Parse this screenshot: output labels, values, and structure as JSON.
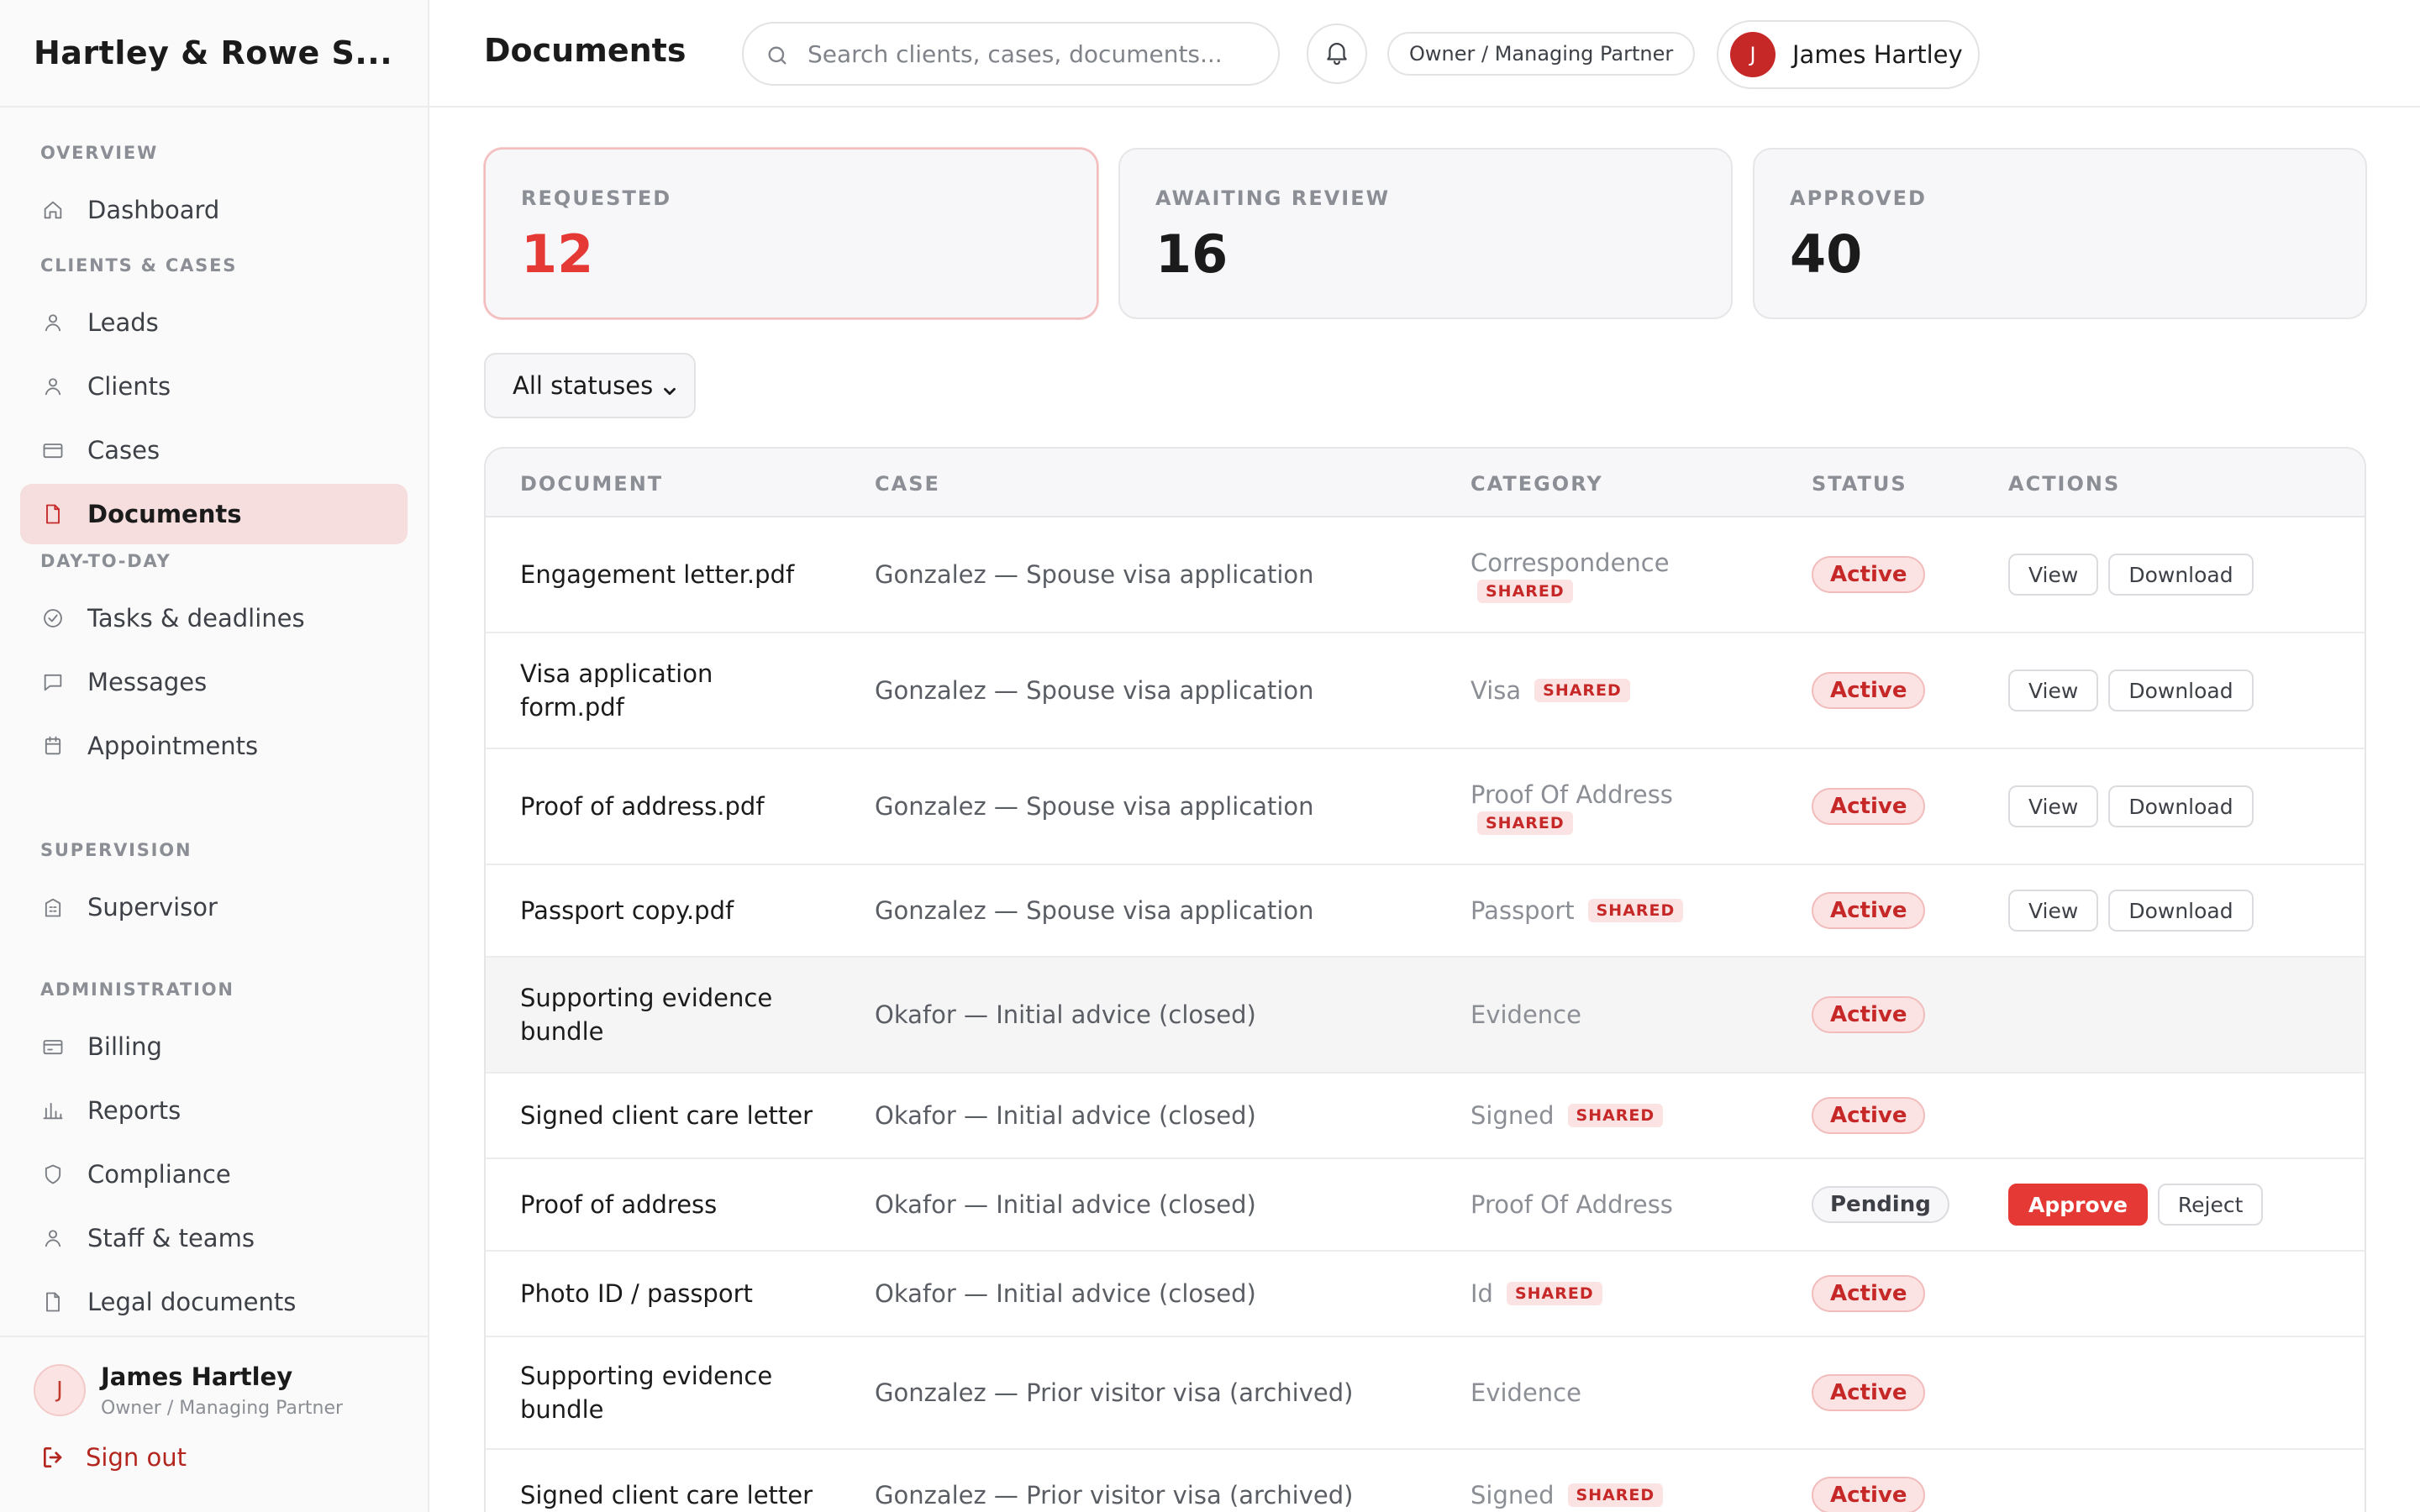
{
  "app": {
    "brand": "Hartley & Rowe S..."
  },
  "sidebar": {
    "sections": [
      {
        "label": "OVERVIEW",
        "items": [
          {
            "label": "Dashboard",
            "icon": "home-icon"
          }
        ]
      },
      {
        "label": "CLIENTS & CASES",
        "items": [
          {
            "label": "Leads",
            "icon": "person-icon"
          },
          {
            "label": "Clients",
            "icon": "person-icon"
          },
          {
            "label": "Cases",
            "icon": "folder-icon"
          },
          {
            "label": "Documents",
            "icon": "document-icon",
            "active": true
          }
        ]
      },
      {
        "label": "DAY-TO-DAY",
        "items": [
          {
            "label": "Tasks & deadlines",
            "icon": "check-circle-icon"
          },
          {
            "label": "Messages",
            "icon": "chat-icon"
          },
          {
            "label": "Appointments",
            "icon": "calendar-icon"
          }
        ]
      },
      {
        "label": "SUPERVISION",
        "items": [
          {
            "label": "Supervisor",
            "icon": "building-icon"
          }
        ]
      },
      {
        "label": "ADMINISTRATION",
        "items": [
          {
            "label": "Billing",
            "icon": "card-icon"
          },
          {
            "label": "Reports",
            "icon": "bar-chart-icon"
          },
          {
            "label": "Compliance",
            "icon": "shield-icon"
          },
          {
            "label": "Staff & teams",
            "icon": "person-icon"
          },
          {
            "label": "Legal documents",
            "icon": "document-icon"
          }
        ]
      }
    ],
    "footer": {
      "avatar_initial": "J",
      "name": "James Hartley",
      "role": "Owner / Managing Partner",
      "signout_label": "Sign out"
    }
  },
  "header": {
    "title": "Documents",
    "search_placeholder": "Search clients, cases, documents...",
    "role_pill": "Owner / Managing Partner",
    "user": {
      "initial": "J",
      "name": "James Hartley"
    }
  },
  "stats": [
    {
      "label": "REQUESTED",
      "value": "12",
      "highlight": true
    },
    {
      "label": "AWAITING REVIEW",
      "value": "16"
    },
    {
      "label": "APPROVED",
      "value": "40"
    }
  ],
  "filter": {
    "selected": "All statuses"
  },
  "table": {
    "headers": {
      "document": "DOCUMENT",
      "case": "CASE",
      "category": "CATEGORY",
      "status": "STATUS",
      "actions": "ACTIONS"
    },
    "shared_label": "SHARED",
    "rows": [
      {
        "document": "Engagement letter.pdf",
        "case": "Gonzalez — Spouse visa application",
        "category": "Correspondence",
        "shared": true,
        "status": "Active",
        "actions": [
          "View",
          "Download"
        ]
      },
      {
        "document": "Visa application form.pdf",
        "case": "Gonzalez — Spouse visa application",
        "category": "Visa",
        "shared": true,
        "status": "Active",
        "actions": [
          "View",
          "Download"
        ]
      },
      {
        "document": "Proof of address.pdf",
        "case": "Gonzalez — Spouse visa application",
        "category": "Proof Of Address",
        "shared": true,
        "status": "Active",
        "actions": [
          "View",
          "Download"
        ]
      },
      {
        "document": "Passport copy.pdf",
        "case": "Gonzalez — Spouse visa application",
        "category": "Passport",
        "shared": true,
        "status": "Active",
        "actions": [
          "View",
          "Download"
        ]
      },
      {
        "document": "Supporting evidence bundle",
        "case": "Okafor — Initial advice (closed)",
        "category": "Evidence",
        "shared": false,
        "status": "Active",
        "actions": []
      },
      {
        "document": "Signed client care letter",
        "case": "Okafor — Initial advice (closed)",
        "category": "Signed",
        "shared": true,
        "status": "Active",
        "actions": []
      },
      {
        "document": "Proof of address",
        "case": "Okafor — Initial advice (closed)",
        "category": "Proof Of Address",
        "shared": false,
        "status": "Pending",
        "actions": [
          "Approve",
          "Reject"
        ]
      },
      {
        "document": "Photo ID / passport",
        "case": "Okafor — Initial advice (closed)",
        "category": "Id",
        "shared": true,
        "status": "Active",
        "actions": []
      },
      {
        "document": "Supporting evidence bundle",
        "case": "Gonzalez — Prior visitor visa (archived)",
        "category": "Evidence",
        "shared": false,
        "status": "Active",
        "actions": []
      },
      {
        "document": "Signed client care letter",
        "case": "Gonzalez — Prior visitor visa (archived)",
        "category": "Signed",
        "shared": true,
        "status": "Active",
        "actions": []
      }
    ]
  },
  "colors": {
    "accent": "#e53935",
    "accent_dark": "#c62828",
    "accent_soft": "#fbe3e3"
  }
}
